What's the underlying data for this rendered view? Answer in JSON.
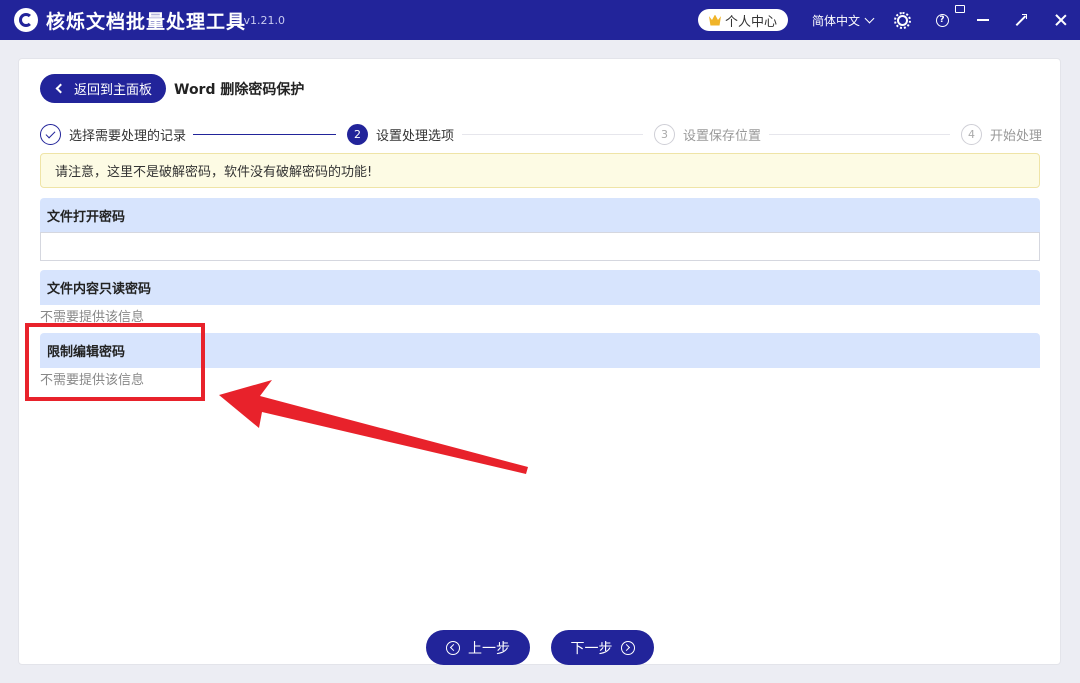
{
  "app": {
    "title": "核烁文档批量处理工具",
    "version": "- v1.21.0",
    "user_center": "个人中心",
    "language": "简体中文",
    "icons": [
      "logo-icon",
      "crown-icon",
      "chevron-down-icon",
      "gear-icon",
      "help-icon",
      "notice-icon",
      "minimize-icon",
      "maximize-icon",
      "close-icon"
    ]
  },
  "header": {
    "back_label": "返回到主面板",
    "page_title": "Word 删除密码保护"
  },
  "steps": [
    {
      "num": "",
      "label": "选择需要处理的记录",
      "state": "done"
    },
    {
      "num": "2",
      "label": "设置处理选项",
      "state": "active"
    },
    {
      "num": "3",
      "label": "设置保存位置",
      "state": "pending"
    },
    {
      "num": "4",
      "label": "开始处理",
      "state": "pending"
    }
  ],
  "notice": "请注意，这里不是破解密码，软件没有破解密码的功能!",
  "sections": {
    "open_password": {
      "title": "文件打开密码",
      "value": ""
    },
    "readonly_password": {
      "title": "文件内容只读密码",
      "hint": "不需要提供该信息"
    },
    "edit_password": {
      "title": "限制编辑密码",
      "hint": "不需要提供该信息"
    }
  },
  "footer": {
    "prev_label": "上一步",
    "next_label": "下一步"
  },
  "colors": {
    "primary": "#22249a",
    "section_bg": "#d7e4fd",
    "notice_bg": "#fdfbe4",
    "annotation": "#e8222b"
  }
}
